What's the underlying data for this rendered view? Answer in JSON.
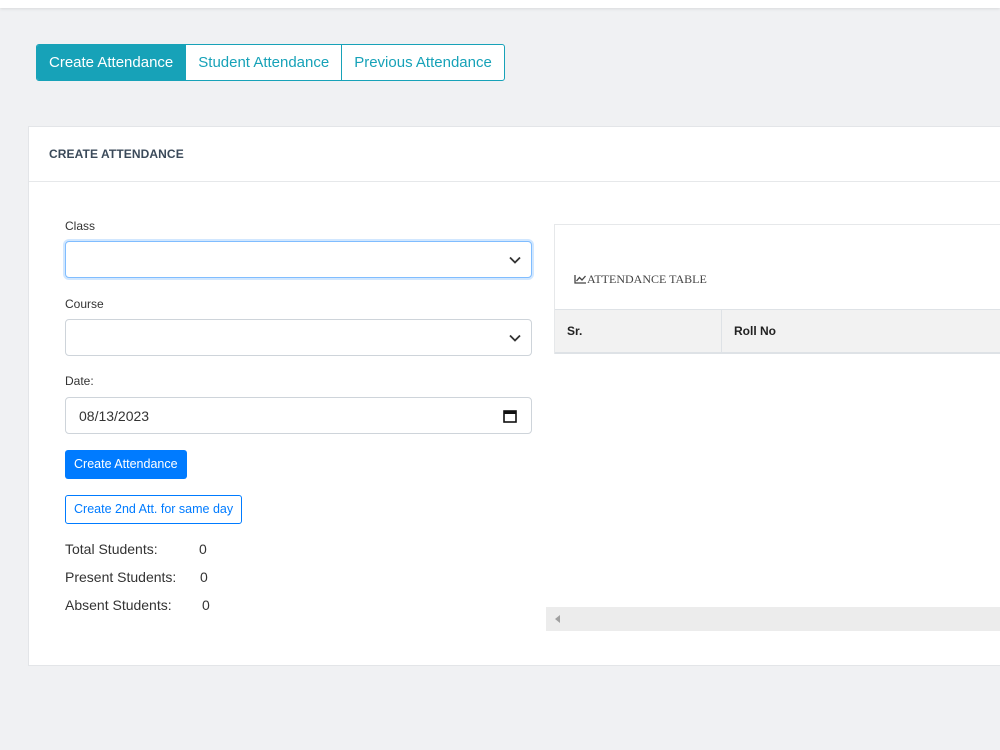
{
  "tabs": [
    {
      "label": "Create Attendance",
      "active": true
    },
    {
      "label": "Student Attendance",
      "active": false
    },
    {
      "label": "Previous Attendance",
      "active": false
    }
  ],
  "card": {
    "title": "CREATE ATTENDANCE"
  },
  "form": {
    "class_label": "Class",
    "class_value": "",
    "course_label": "Course",
    "course_value": "",
    "date_label": "Date:",
    "date_value": "08/13/2023",
    "create_button": "Create Attendance",
    "create_second_button": "Create 2nd Att. for same day"
  },
  "stats": {
    "total_label": "Total Students:",
    "total_value": "0",
    "present_label": "Present Students:",
    "present_value": "0",
    "absent_label": "Absent Students:",
    "absent_value": "0"
  },
  "table": {
    "title": "ATTENDANCE TABLE",
    "icon": "chart-line-icon",
    "columns": [
      "Sr.",
      "Roll No"
    ]
  },
  "colors": {
    "accent": "#17a2b8",
    "primary": "#007bff"
  }
}
